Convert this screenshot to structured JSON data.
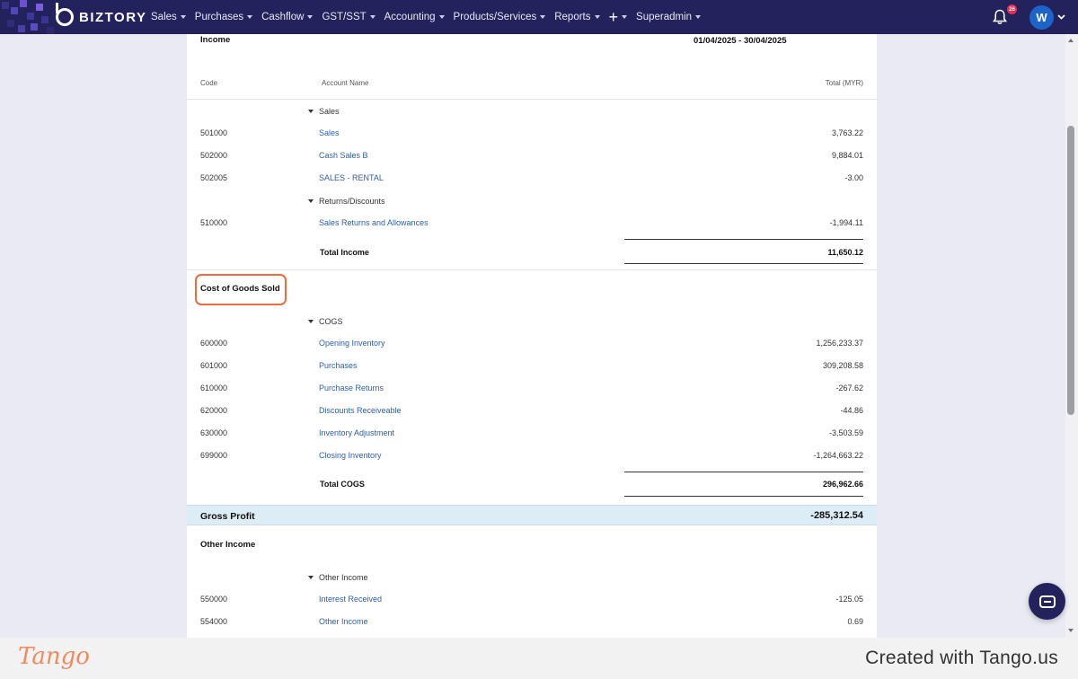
{
  "navbar": {
    "brand": "BIZTORY",
    "menu": [
      {
        "label": "Sales",
        "has_caret": true
      },
      {
        "label": "Purchases",
        "has_caret": true
      },
      {
        "label": "Cashflow",
        "has_caret": true
      },
      {
        "label": "GST/SST",
        "has_caret": true
      },
      {
        "label": "Accounting",
        "has_caret": true
      },
      {
        "label": "Products/Services",
        "has_caret": true
      },
      {
        "label": "Reports",
        "has_caret": true
      },
      {
        "label": "+",
        "has_caret": true
      },
      {
        "label": "Superadmin",
        "has_caret": true
      }
    ],
    "notification_count": "26",
    "avatar_initial": "W",
    "colors": {
      "bar": "#23225d",
      "avatar": "#1d64c8",
      "badge": "#e53054"
    }
  },
  "report": {
    "income": {
      "title": "Income",
      "period": "01/04/2025 - 30/04/2025",
      "columns": {
        "code": "Code",
        "account": "Account Name",
        "total": "Total (MYR)"
      },
      "groups": [
        {
          "name": "Sales",
          "rows": [
            {
              "code": "501000",
              "account": "Sales",
              "total": "3,763.22"
            },
            {
              "code": "502000",
              "account": "Cash Sales B",
              "total": "9,884.01"
            },
            {
              "code": "502005",
              "account": "SALES - RENTAL",
              "total": "-3.00"
            }
          ]
        },
        {
          "name": "Returns/Discounts",
          "rows": [
            {
              "code": "510000",
              "account": "Sales Returns and Allowances",
              "total": "-1,994.11"
            }
          ]
        }
      ],
      "total_label": "Total Income",
      "total_value": "11,650.12"
    },
    "cogs": {
      "title": "Cost of Goods Sold",
      "group": "COGS",
      "rows": [
        {
          "code": "600000",
          "account": "Opening Inventory",
          "total": "1,256,233.37"
        },
        {
          "code": "601000",
          "account": "Purchases",
          "total": "309,208.58"
        },
        {
          "code": "610000",
          "account": "Purchase Returns",
          "total": "-267.62"
        },
        {
          "code": "620000",
          "account": "Discounts Receiveable",
          "total": "-44.86"
        },
        {
          "code": "630000",
          "account": "Inventory Adjustment",
          "total": "-3,503.59"
        },
        {
          "code": "699000",
          "account": "Closing Inventory",
          "total": "-1,264,663.22"
        }
      ],
      "total_label": "Total COGS",
      "total_value": "296,962.66"
    },
    "gross_profit": {
      "label": "Gross Profit",
      "value": "-285,312.54"
    },
    "other_income": {
      "title": "Other Income",
      "group": "Other Income",
      "rows": [
        {
          "code": "550000",
          "account": "Interest Received",
          "total": "-125.05"
        },
        {
          "code": "554000",
          "account": "Other Income",
          "total": "0.69"
        }
      ]
    }
  },
  "footer": {
    "logo": "Tango",
    "created_with": "Created with Tango.us"
  }
}
